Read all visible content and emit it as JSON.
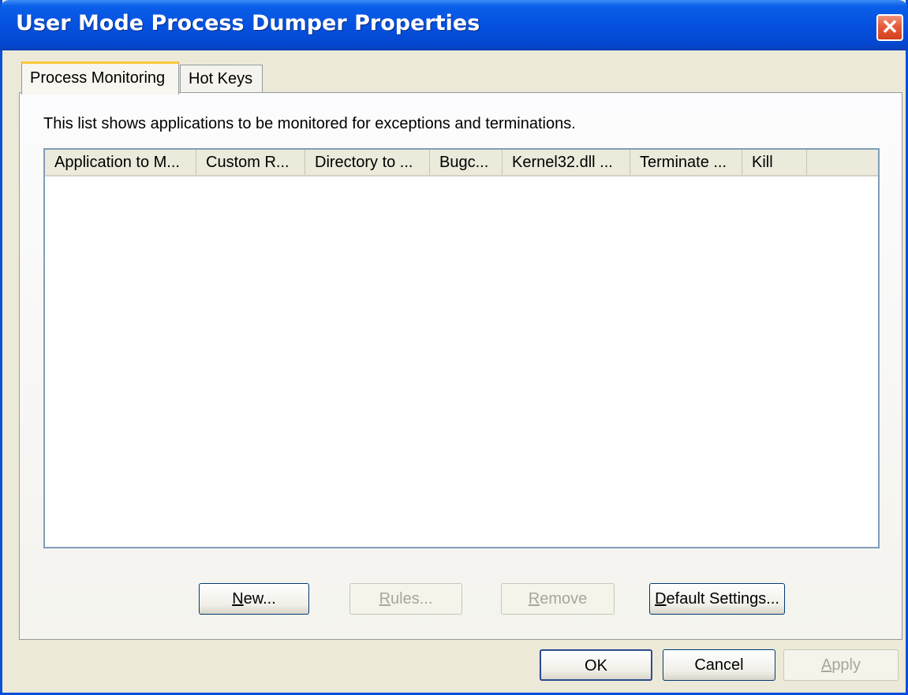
{
  "window": {
    "title": "User Mode Process Dumper Properties",
    "close_glyph": "✕"
  },
  "tabs": [
    {
      "label": "Process Monitoring",
      "active": true
    },
    {
      "label": "Hot Keys",
      "active": false
    }
  ],
  "panel": {
    "description": "This list shows applications to be monitored for exceptions and terminations."
  },
  "list": {
    "columns": [
      "Application to M...",
      "Custom R...",
      "Directory to ...",
      "Bugc...",
      "Kernel32.dll ...",
      "Terminate ...",
      "Kill"
    ],
    "rows": []
  },
  "panel_buttons": {
    "new": {
      "prefix": "",
      "mnemonic": "N",
      "rest": "ew..."
    },
    "rules": {
      "prefix": "",
      "mnemonic": "R",
      "rest": "ules..."
    },
    "remove": {
      "prefix": "",
      "mnemonic": "R",
      "rest": "emove"
    },
    "default_settings": {
      "prefix": "",
      "mnemonic": "D",
      "rest": "efault Settings..."
    }
  },
  "dialog_buttons": {
    "ok": "OK",
    "cancel": "Cancel",
    "apply": {
      "mnemonic": "A",
      "rest": "pply"
    }
  }
}
